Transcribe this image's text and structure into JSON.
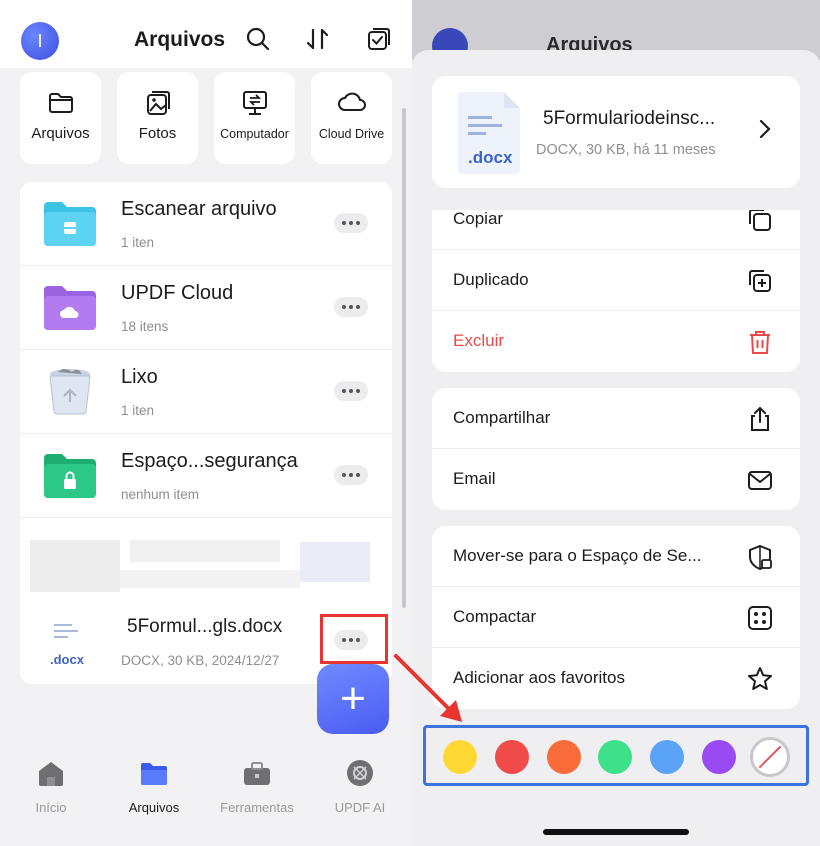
{
  "left": {
    "header": {
      "avatar_letter": "I",
      "title": "Arquivos"
    },
    "quick": [
      {
        "label": "Arquivos",
        "icon": "folder-icon"
      },
      {
        "label": "Fotos",
        "icon": "photos-icon"
      },
      {
        "label": "Computador",
        "icon": "computer-icon"
      },
      {
        "label": "Cloud Drive",
        "icon": "cloud-icon"
      }
    ],
    "rows": [
      {
        "name": "Escanear arquivo",
        "sub": "1 iten"
      },
      {
        "name": "UPDF Cloud",
        "sub": "18 itens"
      },
      {
        "name": "Lixo",
        "sub": "1 iten"
      },
      {
        "name": "Espaço...segurança",
        "sub": "nenhum item"
      }
    ],
    "doc": {
      "ext": ".docx",
      "name": "5Formul...gls.docx",
      "sub": "DOCX, 30 KB, 2024/12/27"
    },
    "fab": "+",
    "tabs": [
      {
        "label": "Início"
      },
      {
        "label": "Arquivos"
      },
      {
        "label": "Ferramentas"
      },
      {
        "label": "UPDF AI"
      }
    ]
  },
  "right": {
    "header": {
      "title": "Arquivos"
    },
    "file": {
      "ext": ".docx",
      "name": "5Formulariodeinsc...",
      "sub": "DOCX, 30 KB, há 11 meses"
    },
    "group1": [
      {
        "label": "Copiar"
      },
      {
        "label": "Duplicado"
      },
      {
        "label": "Excluir"
      }
    ],
    "group2": [
      {
        "label": "Compartilhar"
      },
      {
        "label": "Email"
      }
    ],
    "group3": [
      {
        "label": "Mover-se para o Espaço de Se..."
      },
      {
        "label": "Compactar"
      },
      {
        "label": "Adicionar aos favoritos"
      }
    ],
    "colors": [
      "#fdd835",
      "#f24b4b",
      "#fa6b3a",
      "#3fe08a",
      "#5aa3f7",
      "#9a4af2"
    ]
  },
  "accent": "#4a5cf2",
  "danger": "#e8494a",
  "highlight_red": "#e8352f",
  "highlight_blue": "#3b73e0"
}
